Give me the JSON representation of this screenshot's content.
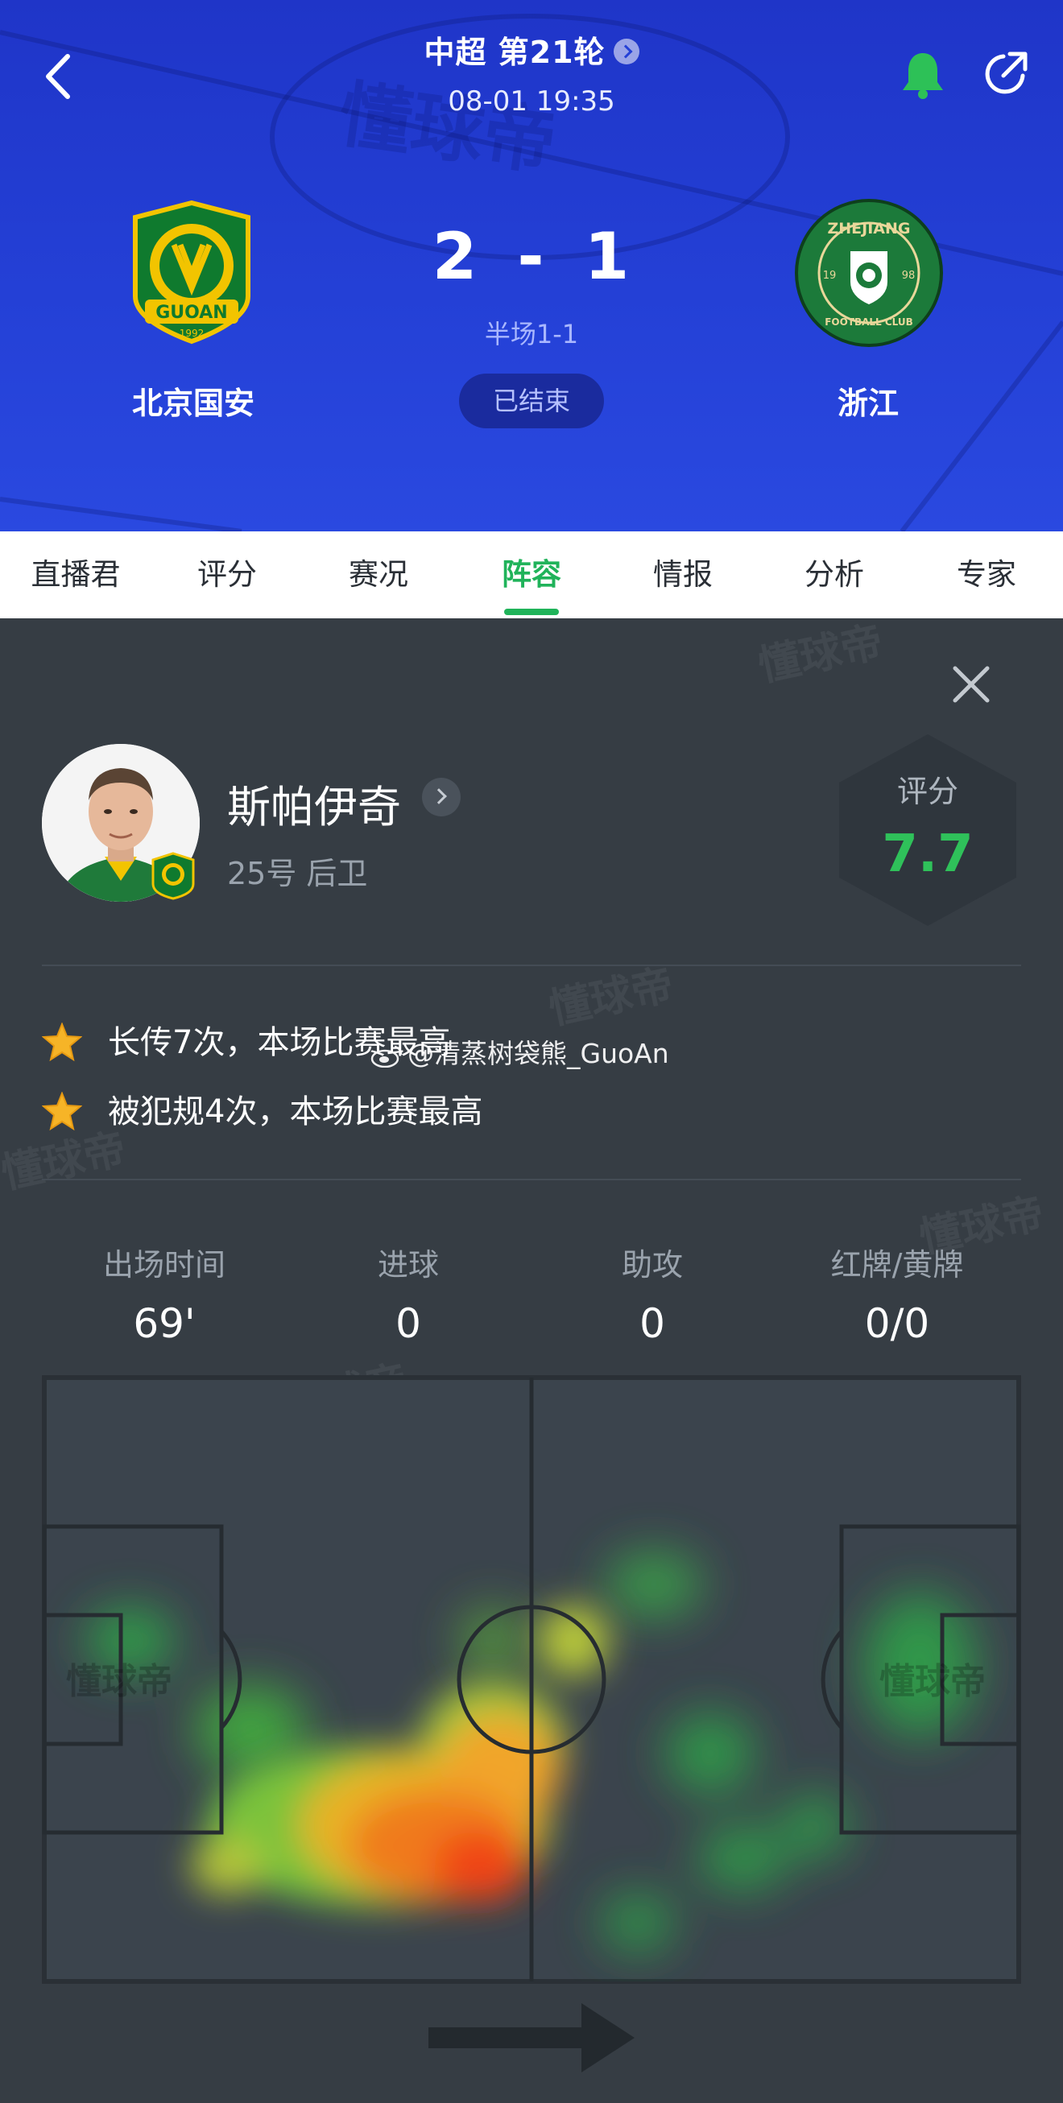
{
  "header": {
    "round_title": "中超 第21轮",
    "match_time": "08-01 19:35",
    "home_team": "北京国安",
    "away_team": "浙江",
    "home_score": "2",
    "away_score": "1",
    "score_separator": "-",
    "half_time": "半场1-1",
    "status": "已结束",
    "home_crest_text": "GUOAN",
    "home_crest_year": "1992",
    "away_crest_text": "ZHEJIANG",
    "away_crest_sub": "FOOTBALL CLUB",
    "away_crest_left": "19",
    "away_crest_right": "98"
  },
  "tabs": [
    "直播君",
    "评分",
    "赛况",
    "阵容",
    "情报",
    "分析",
    "专家"
  ],
  "active_tab": "阵容",
  "player": {
    "name": "斯帕伊奇",
    "meta": "25号 后卫",
    "rating_label": "评分",
    "rating": "7.7"
  },
  "highlights": [
    "长传7次，本场比赛最高",
    "被犯规4次，本场比赛最高"
  ],
  "stats": [
    {
      "label": "出场时间",
      "value": "69'"
    },
    {
      "label": "进球",
      "value": "0"
    },
    {
      "label": "助攻",
      "value": "0"
    },
    {
      "label": "红牌/黄牌",
      "value": "0/0"
    }
  ],
  "watermark_weibo": "@清蒸树袋熊_GuoAn",
  "watermark_brand": "懂球帝",
  "colors": {
    "header_blue": "#2440d6",
    "accent_green": "#20b35a",
    "rating_green": "#2fc15a",
    "panel_bg": "#363d44"
  },
  "icons": [
    "back-icon",
    "bell-icon",
    "share-icon",
    "close-icon",
    "star-icon",
    "chevron-right-icon",
    "arrow-right-icon"
  ]
}
